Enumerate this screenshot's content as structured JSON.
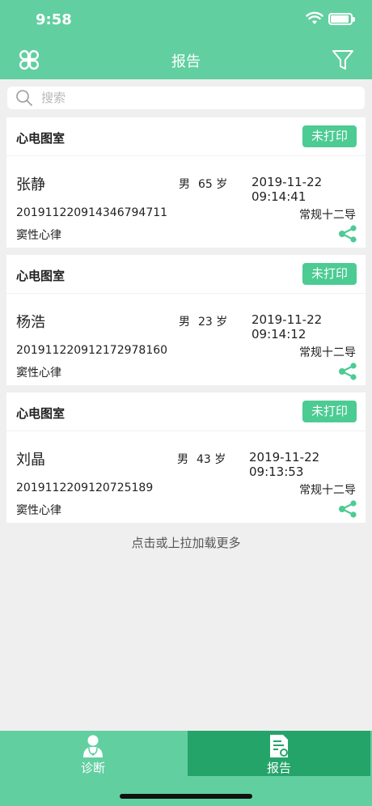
{
  "status_bar": {
    "time": "9:58"
  },
  "navbar": {
    "title": "报告"
  },
  "search": {
    "placeholder": "搜索"
  },
  "reports": [
    {
      "department": "心电图室",
      "print_status": "未打印",
      "name": "张静",
      "gender": "男",
      "age": "65 岁",
      "datetime": "2019-11-22 09:14:41",
      "report_id": "201911220914346794711",
      "exam_type": "常规十二导",
      "diagnosis": "窦性心律"
    },
    {
      "department": "心电图室",
      "print_status": "未打印",
      "name": "杨浩",
      "gender": "男",
      "age": "23 岁",
      "datetime": "2019-11-22 09:14:12",
      "report_id": "20191122091217297816​0",
      "exam_type": "常规十二导",
      "diagnosis": "窦性心律"
    },
    {
      "department": "心电图室",
      "print_status": "未打印",
      "name": "刘晶",
      "gender": "男",
      "age": "43 岁",
      "datetime": "2019-11-22 09:13:53",
      "report_id": "2019112209120725189",
      "exam_type": "常规十二导",
      "diagnosis": "窦性心律"
    }
  ],
  "load_more": "点击或上拉加载更多",
  "tabs": [
    {
      "label": "诊断",
      "icon": "doctor-icon",
      "active": false
    },
    {
      "label": "报告",
      "icon": "report-icon",
      "active": true
    }
  ],
  "colors": {
    "primary": "#62cfa1",
    "button": "#4ccb93",
    "tab_active": "#25a46a"
  }
}
